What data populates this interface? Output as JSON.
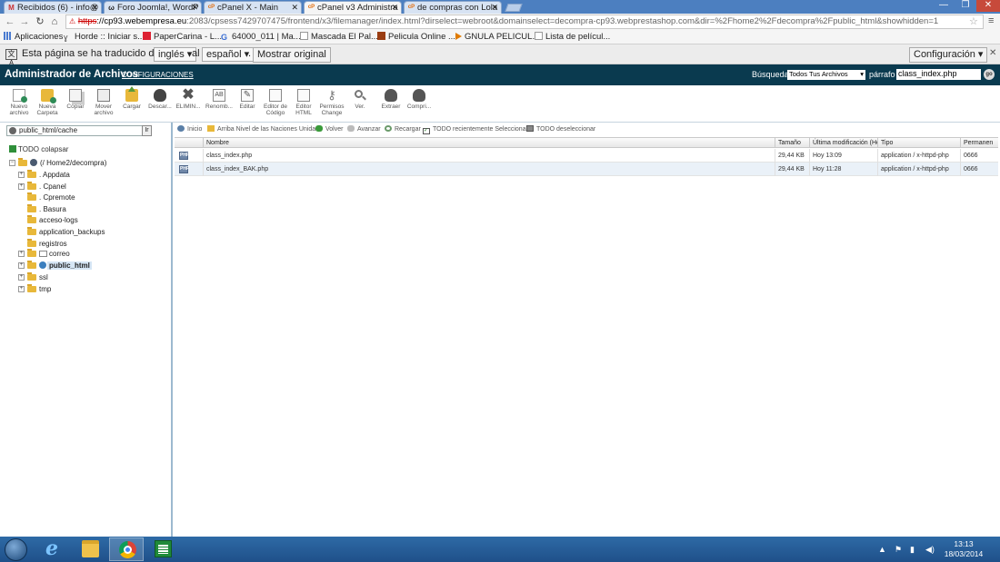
{
  "browser": {
    "tabs": [
      {
        "favicon": "gmail-icon",
        "fav_char": "M",
        "fav_color": "#c33",
        "label": "Recibidos (6) - info@"
      },
      {
        "favicon": "joomla-icon",
        "fav_char": "ω",
        "fav_color": "#333",
        "label": "Foro Joomla!, WordP"
      },
      {
        "favicon": "cpanel-icon",
        "fav_char": "cP",
        "fav_color": "#e36c0a",
        "label": "cPanel X - Main"
      },
      {
        "favicon": "cpanel-icon",
        "fav_char": "cP",
        "fav_color": "#e36c0a",
        "label": "cPanel v3 Administra"
      },
      {
        "favicon": "cpanel-icon",
        "fav_char": "cP",
        "fav_color": "#e36c0a",
        "label": "de compras con Lola"
      }
    ],
    "active_tab": 3,
    "url": {
      "scheme": "https",
      "host": "://cp93.webempresa.eu",
      "rest": ":2083/cpsess7429707475/frontend/x3/filemanager/index.html?dirselect=webroot&domainselect=decompra-cp93.webprestashop.com&dir=%2Fhome2%2Fdecompra%2Fpublic_html&showhidden=1"
    },
    "bookmarks": [
      {
        "icon": "apps-icon",
        "color": "#4a7bd0",
        "label": "Aplicaciones"
      },
      {
        "icon": "horde-icon",
        "color": "#555",
        "label": "Horde :: Iniciar s..."
      },
      {
        "icon": "papercarina-icon",
        "color": "#d23",
        "label": "PaperCarina - L..."
      },
      {
        "icon": "google-icon",
        "color": "#3b6fd4",
        "label": "64000_011 | Ma..."
      },
      {
        "icon": "page-icon",
        "color": "#ddd",
        "label": "Mascada El Pal..."
      },
      {
        "icon": "movie-icon",
        "color": "#9a3d12",
        "label": "Pelicula Online ..."
      },
      {
        "icon": "play-icon",
        "color": "#e07b00",
        "label": "GNULA PELICUL..."
      },
      {
        "icon": "page-icon",
        "color": "#ddd",
        "label": "Lista de películ..."
      }
    ]
  },
  "translate_bar": {
    "prefix": "Esta página se ha traducido del",
    "from_lang": "inglés",
    "connector": "al",
    "to_lang": "español",
    "dot": ".",
    "show_original": "Mostrar original",
    "settings": "Configuración"
  },
  "cpanel": {
    "title": "Administrador de Archivos",
    "config_link": "CONFIGURACIONES",
    "search_label": "Búsqueda",
    "search_scope": "Todos Tus Archivos",
    "para_label": "párrafo",
    "search_value": "class_index.php",
    "go_label": "go"
  },
  "toolbar": [
    {
      "icon": "new-file-icon",
      "color": "#2e8b57",
      "label": "Nuevo archivo"
    },
    {
      "icon": "new-folder-icon",
      "color": "#e8b83a",
      "label": "Nueva Carpeta"
    },
    {
      "icon": "copy-icon",
      "color": "#8a8a8a",
      "label": "Copiar"
    },
    {
      "icon": "move-file-icon",
      "color": "#7a7a7a",
      "label": "Mover archivo"
    },
    {
      "icon": "upload-icon",
      "color": "#5a9a3a",
      "label": "Cargar"
    },
    {
      "icon": "download-icon",
      "color": "#444",
      "label": "Descar..."
    },
    {
      "icon": "delete-icon",
      "color": "#555",
      "label": "ELIMIN..."
    },
    {
      "icon": "rename-icon",
      "color": "#666",
      "label": "Renomb..."
    },
    {
      "icon": "edit-icon",
      "color": "#666",
      "label": "Editar"
    },
    {
      "icon": "code-editor-icon",
      "color": "#777",
      "label": "Editor de Código"
    },
    {
      "icon": "html-editor-icon",
      "color": "#777",
      "label": "Editor HTML"
    },
    {
      "icon": "permissions-icon",
      "color": "#777",
      "label": "Permisos Change"
    },
    {
      "icon": "view-icon",
      "color": "#777",
      "label": "Ver."
    },
    {
      "icon": "extract-icon",
      "color": "#555",
      "label": "Extraer"
    },
    {
      "icon": "compress-icon",
      "color": "#555",
      "label": "Compri..."
    }
  ],
  "left_pane": {
    "path_value": "public_html/cache",
    "go_button": "Ir",
    "collapse_all": "TODO colapsar",
    "tree": [
      {
        "label": "(/ Home2/decompra)",
        "expander": "−",
        "level": 0
      },
      {
        "label": ". Appdata",
        "expander": "+",
        "level": 1
      },
      {
        "label": ". Cpanel",
        "expander": "+",
        "level": 1
      },
      {
        "label": ". Cpremote",
        "expander": "",
        "level": 1
      },
      {
        "label": ". Basura",
        "expander": "",
        "level": 1
      },
      {
        "label": "acceso-logs",
        "expander": "",
        "level": 1
      },
      {
        "label": "application_backups",
        "expander": "",
        "level": 1
      },
      {
        "label": "registros",
        "expander": "",
        "level": 1
      },
      {
        "label": "correo",
        "expander": "+",
        "level": 1
      },
      {
        "label": "public_html",
        "expander": "+",
        "level": 1,
        "selected": true
      },
      {
        "label": "ssl",
        "expander": "+",
        "level": 1
      },
      {
        "label": "tmp",
        "expander": "+",
        "level": 1
      }
    ]
  },
  "right_nav": [
    {
      "icon": "home-icon",
      "label": "Inicio"
    },
    {
      "icon": "up-level-icon",
      "label": "Arriba Nivel de las Naciones Unidas"
    },
    {
      "icon": "back-icon",
      "label": "Volver"
    },
    {
      "icon": "forward-icon",
      "label": "Avanzar"
    },
    {
      "icon": "reload-icon",
      "label": "Recargar"
    },
    {
      "icon": "select-all-icon",
      "label": "TODO recientemente Seleccionar"
    },
    {
      "icon": "deselect-all-icon",
      "label": "TODO deseleccionar"
    }
  ],
  "files": {
    "columns": [
      "Nombre",
      "Tamaño",
      "Última modificación (Hora",
      "Tipo",
      "Permanen"
    ],
    "rows": [
      {
        "name": "class_index.php",
        "size": "29,44 KB",
        "modified": "Hoy 13:09",
        "type": "application / x-httpd-php",
        "perms": "0666"
      },
      {
        "name": "class_index_BAK.php",
        "size": "29,44 KB",
        "modified": "Hoy 11:28",
        "type": "application / x-httpd-php",
        "perms": "0666"
      }
    ]
  },
  "taskbar": {
    "time": "13:13",
    "date": "18/03/2014"
  }
}
